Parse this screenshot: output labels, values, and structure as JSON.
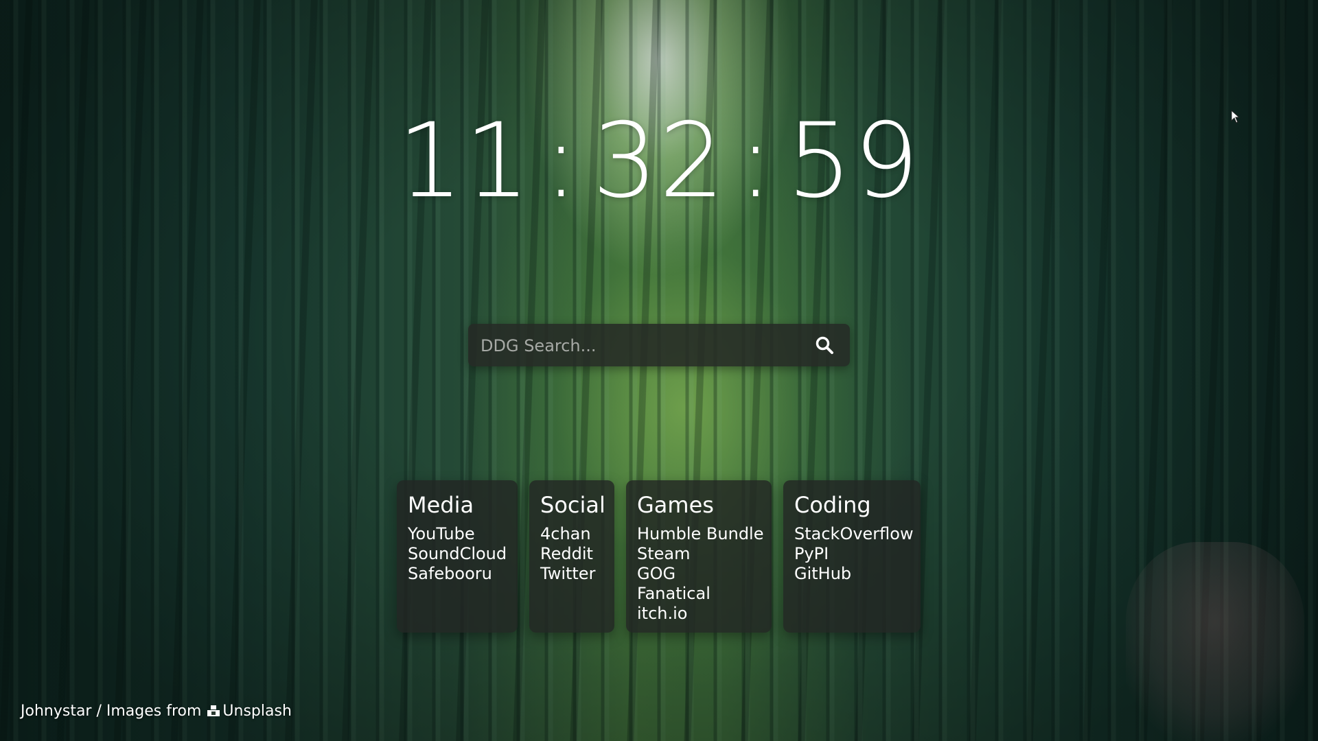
{
  "clock": {
    "hours": "11",
    "minutes": "32",
    "seconds": "59",
    "separator": ":"
  },
  "search": {
    "placeholder": "DDG Search...",
    "icon": "search-icon"
  },
  "cards": [
    {
      "title": "Media",
      "links": [
        "YouTube",
        "SoundCloud",
        "Safebooru"
      ]
    },
    {
      "title": "Social",
      "links": [
        "4chan",
        "Reddit",
        "Twitter"
      ]
    },
    {
      "title": "Games",
      "links": [
        "Humble Bundle",
        "Steam",
        "GOG",
        "Fanatical",
        "itch.io"
      ]
    },
    {
      "title": "Coding",
      "links": [
        "StackOverflow",
        "PyPI",
        "GitHub"
      ]
    }
  ],
  "footer": {
    "credit_prefix": "Johnystar / Images from",
    "source": "Unsplash",
    "source_icon": "camera-icon"
  },
  "colors": {
    "card_bg": "#222623",
    "search_bg": "#262a26",
    "text": "#ffffff",
    "placeholder": "#a7aaa6"
  }
}
